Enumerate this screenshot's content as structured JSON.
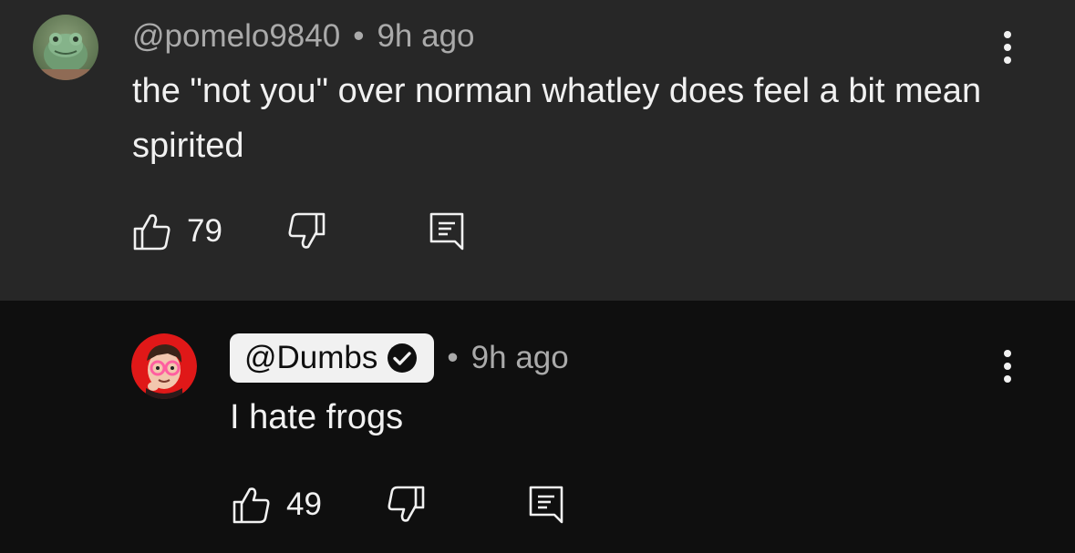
{
  "comments": [
    {
      "author": "@pomelo9840",
      "time": "9h ago",
      "text": "the \"not you\" over norman whatley does feel a bit mean spirited",
      "likes": "79",
      "is_creator": false,
      "avatar": "frog-avatar"
    },
    {
      "author": "@Dumbs",
      "time": "9h ago",
      "text": "I hate frogs",
      "likes": "49",
      "is_creator": true,
      "verified": true,
      "avatar": "cartoon-man-avatar"
    }
  ],
  "separator": "•",
  "colors": {
    "thread_bg": "#272727",
    "page_bg": "#0f0f0f",
    "text_primary": "#f1f1f1",
    "text_secondary": "#aaaaaa",
    "creator_chip_bg": "#f1f1f1"
  },
  "icons": {
    "like": "thumbs-up-icon",
    "dislike": "thumbs-down-icon",
    "reply": "reply-comment-icon",
    "more": "more-vertical-icon",
    "verified": "verified-check-icon"
  }
}
